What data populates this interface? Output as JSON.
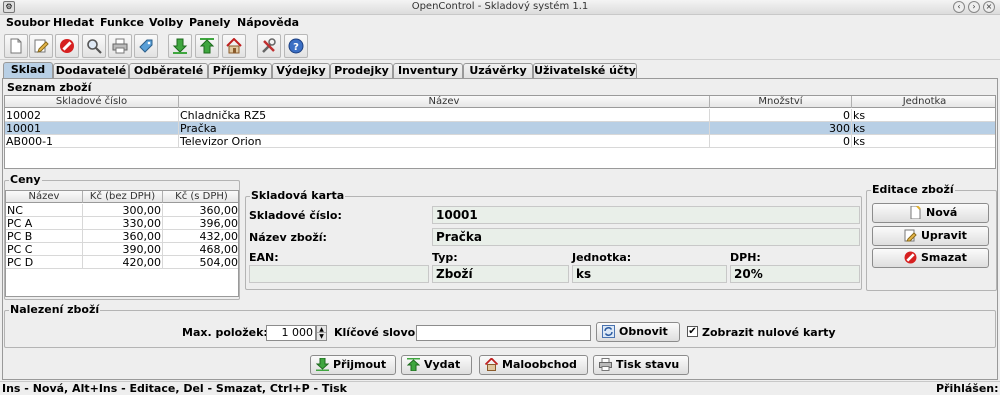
{
  "window": {
    "title": "OpenControl - Skladový systém 1.1"
  },
  "menu": [
    "Soubor",
    "Hledat",
    "Funkce",
    "Volby",
    "Panely",
    "Nápověda"
  ],
  "toolbar": [
    "new-document-icon",
    "edit-icon",
    "cancel-icon",
    "search-icon",
    "print-icon",
    "tag-icon",
    "import-icon",
    "export-icon",
    "home-icon",
    "tools-icon",
    "help-icon"
  ],
  "tabs": [
    "Sklad",
    "Dodavatelé",
    "Odběratelé",
    "Příjemky",
    "Výdejky",
    "Prodejky",
    "Inventury",
    "Uzávěrky",
    "Uživatelské účty"
  ],
  "seznam": {
    "title": "Seznam zboží",
    "headers": [
      "Skladové číslo",
      "Název",
      "Množství",
      "Jednotka"
    ],
    "rows": [
      {
        "cislo": "10002",
        "nazev": "Chladnička RZ5",
        "mnozstvi": "0",
        "jednotka": "ks"
      },
      {
        "cislo": "10001",
        "nazev": "Pračka",
        "mnozstvi": "300",
        "jednotka": "ks"
      },
      {
        "cislo": "AB000-1",
        "nazev": "Televizor Orion",
        "mnozstvi": "0",
        "jednotka": "ks"
      }
    ],
    "selected": 1
  },
  "ceny": {
    "title": "Ceny",
    "headers": [
      "Název",
      "Kč (bez DPH)",
      "Kč (s DPH)"
    ],
    "rows": [
      [
        "NC",
        "300,00",
        "360,00"
      ],
      [
        "PC A",
        "330,00",
        "396,00"
      ],
      [
        "PC B",
        "360,00",
        "432,00"
      ],
      [
        "PC C",
        "390,00",
        "468,00"
      ],
      [
        "PC D",
        "420,00",
        "504,00"
      ]
    ]
  },
  "karta": {
    "title": "Skladová karta",
    "cislo_label": "Skladové číslo:",
    "cislo": "10001",
    "nazev_label": "Název zboží:",
    "nazev": "Pračka",
    "ean_label": "EAN:",
    "ean": "",
    "typ_label": "Typ:",
    "typ": "Zboží",
    "jednotka_label": "Jednotka:",
    "jednotka": "ks",
    "dph_label": "DPH:",
    "dph": "20%"
  },
  "editace": {
    "title": "Editace zboží",
    "nova": "Nová",
    "upravit": "Upravit",
    "smazat": "Smazat"
  },
  "nalezeni": {
    "title": "Nalezení zboží",
    "max_label": "Max. položek:",
    "max_value": "1 000",
    "klic_label": "Klíčové slovo:",
    "klic_value": "",
    "obnovit": "Obnovit",
    "nulove_label": "Zobrazit nulové karty",
    "nulove_checked": true
  },
  "actions": {
    "prijmout": "Přijmout",
    "vydat": "Vydat",
    "maloobchod": "Maloobchod",
    "tisk": "Tisk stavu"
  },
  "status": {
    "hint": "Ins - Nová, Alt+Ins - Editace, Del - Smazat, Ctrl+P - Tisk",
    "right": "Přihlášen:"
  },
  "colors": {
    "selection": "#b8cfe5",
    "field": "#e9efe9"
  }
}
